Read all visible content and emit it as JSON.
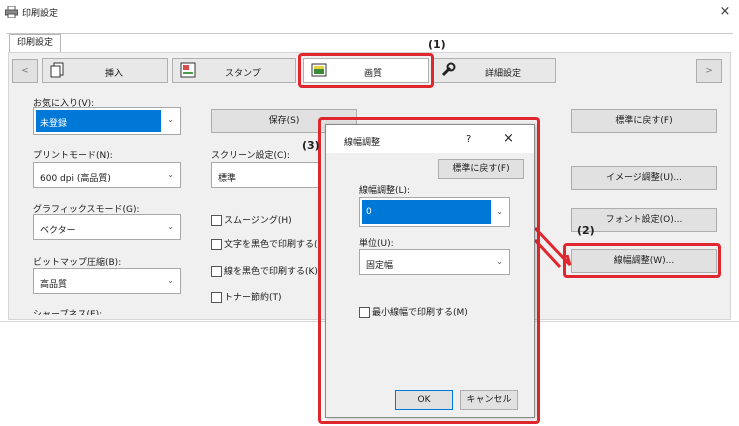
{
  "window": {
    "title": "印刷設定",
    "close_glyph": "×",
    "tab_label": "印刷設定"
  },
  "nav": {
    "prev": "<",
    "next": ">"
  },
  "tabs": [
    {
      "label": "挿入",
      "icon": "insert-icon"
    },
    {
      "label": "スタンプ",
      "icon": "stamp-icon"
    },
    {
      "label": "画質",
      "icon": "image-quality-icon"
    },
    {
      "label": "詳細設定",
      "icon": "wrench-icon"
    }
  ],
  "favorites": {
    "label": "お気に入り(V):",
    "value": "未登録",
    "save": "保存(S)"
  },
  "reset_default": "標準に戻す(F)",
  "print_mode": {
    "label": "プリントモード(N):",
    "value": "600 dpi (高品質)"
  },
  "screen": {
    "label": "スクリーン設定(C):",
    "value": "標準"
  },
  "graphics": {
    "label": "グラフィックスモード(G):",
    "value": "ベクター"
  },
  "bitmap": {
    "label": "ビットマップ圧縮(B):",
    "value": "高品質"
  },
  "cut_label": "シャープネス(E):",
  "checks": [
    {
      "label": "スムージング(H)"
    },
    {
      "label": "文字を黒色で印刷する("
    },
    {
      "label": "線を黒色で印刷する(K)"
    },
    {
      "label": "トナー節約(T)"
    }
  ],
  "right_buttons": {
    "image_adjust": "イメージ調整(U)...",
    "font": "フォント設定(O)...",
    "line_width": "線幅調整(W)..."
  },
  "callouts": {
    "one": "(1)",
    "two": "(2)",
    "three": "(3)"
  },
  "dialog": {
    "title": "線幅調整",
    "help": "?",
    "close": "×",
    "reset": "標準に戻す(F)",
    "width_label": "線幅調整(L):",
    "width_value": "0",
    "unit_label": "単位(U):",
    "unit_value": "固定幅",
    "min_width": "最小線幅で印刷する(M)",
    "ok": "OK",
    "cancel": "キャンセル"
  },
  "colors": {
    "accent_red": "#e0272f",
    "selection_blue": "#0078d7"
  }
}
